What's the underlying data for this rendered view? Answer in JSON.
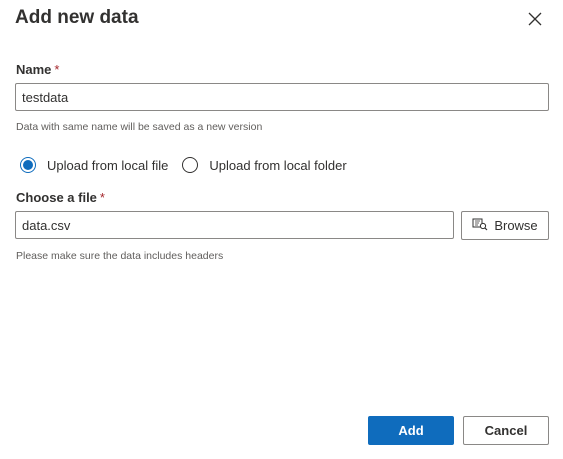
{
  "dialog": {
    "title": "Add new data",
    "close_icon": "close-icon"
  },
  "name_field": {
    "label": "Name",
    "required_marker": "*",
    "value": "testdata",
    "hint": "Data with same name will be saved as a new version"
  },
  "source_options": {
    "options": [
      {
        "label": "Upload from local file",
        "selected": true
      },
      {
        "label": "Upload from local folder",
        "selected": false
      }
    ]
  },
  "file_field": {
    "label": "Choose a file",
    "required_marker": "*",
    "value": "data.csv",
    "browse_label": "Browse",
    "browse_icon": "browse-folder-icon",
    "hint": "Please make sure the data includes headers"
  },
  "footer": {
    "add_label": "Add",
    "cancel_label": "Cancel"
  },
  "colors": {
    "primary": "#0f6cbd",
    "required": "#a4262c",
    "border": "#8a8886"
  }
}
